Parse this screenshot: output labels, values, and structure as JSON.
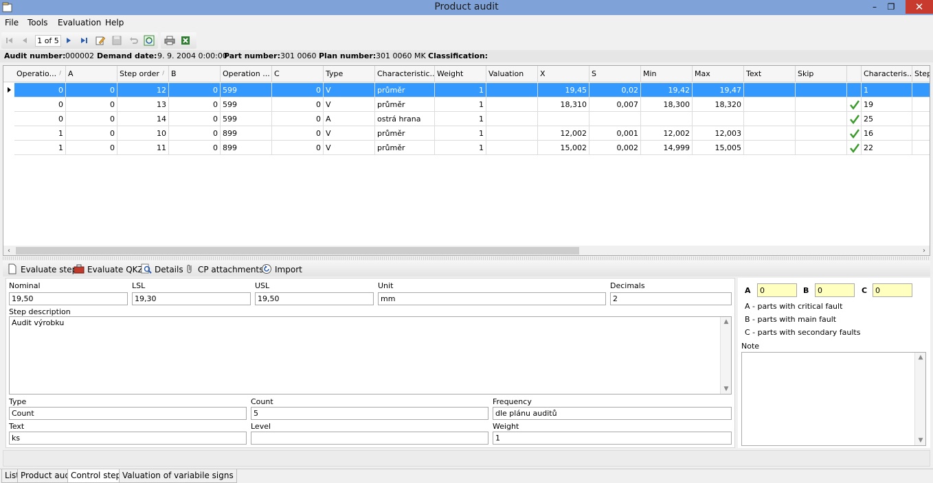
{
  "window": {
    "title": "Product audit",
    "icon": "app-icon",
    "controls": [
      "minimize-icon",
      "restore-icon",
      "close-icon"
    ]
  },
  "menu": [
    "File",
    "Tools",
    "Evaluation",
    "Help"
  ],
  "toolbar": {
    "position": "1 of 5"
  },
  "info": {
    "audit_number_label": "Audit number:",
    "audit_number": "000002",
    "demand_date_label": "Demand date:",
    "demand_date": "9. 9. 2004 0:00:00",
    "part_number_label": "Part number:",
    "part_number": "301 0060",
    "plan_number_label": "Plan number:",
    "plan_number": "301 0060 MK",
    "classification_label": "Classification:",
    "classification": ""
  },
  "grid": {
    "columns": [
      "Operatio...",
      "A",
      "Step order",
      "B",
      "Operation ...",
      "C",
      "Type",
      "Characteristic...",
      "Weight",
      "Valuation",
      "X",
      "S",
      "Min",
      "Max",
      "Text",
      "Skip",
      "",
      "Characteris...",
      "Step"
    ],
    "rows": [
      {
        "op": "0",
        "a": "0",
        "step": "12",
        "b": "0",
        "operation": "599",
        "c": "0",
        "type": "V",
        "char": "průměr",
        "weight": "1",
        "valuation": "",
        "x": "19,45",
        "s": "0,02",
        "min": "19,42",
        "max": "19,47",
        "text": "",
        "skip": "",
        "check": false,
        "characteris": "1",
        "stepcol": ""
      },
      {
        "op": "0",
        "a": "0",
        "step": "13",
        "b": "0",
        "operation": "599",
        "c": "0",
        "type": "V",
        "char": "průměr",
        "weight": "1",
        "valuation": "",
        "x": "18,310",
        "s": "0,007",
        "min": "18,300",
        "max": "18,320",
        "text": "",
        "skip": "",
        "check": true,
        "characteris": "19",
        "stepcol": ""
      },
      {
        "op": "0",
        "a": "0",
        "step": "14",
        "b": "0",
        "operation": "599",
        "c": "0",
        "type": "A",
        "char": "ostrá hrana",
        "weight": "1",
        "valuation": "",
        "x": "",
        "s": "",
        "min": "",
        "max": "",
        "text": "",
        "skip": "",
        "check": true,
        "characteris": "25",
        "stepcol": ""
      },
      {
        "op": "1",
        "a": "0",
        "step": "10",
        "b": "0",
        "operation": "899",
        "c": "0",
        "type": "V",
        "char": "průměr",
        "weight": "1",
        "valuation": "",
        "x": "12,002",
        "s": "0,001",
        "min": "12,002",
        "max": "12,003",
        "text": "",
        "skip": "",
        "check": true,
        "characteris": "16",
        "stepcol": ""
      },
      {
        "op": "1",
        "a": "0",
        "step": "11",
        "b": "0",
        "operation": "899",
        "c": "0",
        "type": "V",
        "char": "průměr",
        "weight": "1",
        "valuation": "",
        "x": "15,002",
        "s": "0,002",
        "min": "14,999",
        "max": "15,005",
        "text": "",
        "skip": "",
        "check": true,
        "characteris": "22",
        "stepcol": ""
      }
    ]
  },
  "actions": [
    "Evaluate step",
    "Evaluate QKZ",
    "Details",
    "CP attachments",
    "Import"
  ],
  "detail": {
    "nominal_label": "Nominal",
    "nominal": "19,50",
    "lsl_label": "LSL",
    "lsl": "19,30",
    "usl_label": "USL",
    "usl": "19,50",
    "unit_label": "Unit",
    "unit": "mm",
    "decimals_label": "Decimals",
    "decimals": "2",
    "step_description_label": "Step description",
    "step_description": "Audit výrobku",
    "type_label": "Type",
    "type": "Count",
    "count_label": "Count",
    "count": "5",
    "frequency_label": "Frequency",
    "frequency": "dle plánu auditů",
    "text_label": "Text",
    "text": "ks",
    "level_label": "Level",
    "level": "",
    "weight_label": "Weight",
    "weight": "1"
  },
  "side": {
    "a_label": "A",
    "a_value": "0",
    "b_label": "B",
    "b_value": "0",
    "c_label": "C",
    "c_value": "0",
    "legend_a": "A - parts with critical fault",
    "legend_b": "B - parts with main fault",
    "legend_c": "C - parts with secondary faults",
    "note_label": "Note",
    "note": ""
  },
  "tabs": [
    "List",
    "Product audit",
    "Control steps",
    "Valuation of variabile signs"
  ],
  "active_tab": "Control steps"
}
